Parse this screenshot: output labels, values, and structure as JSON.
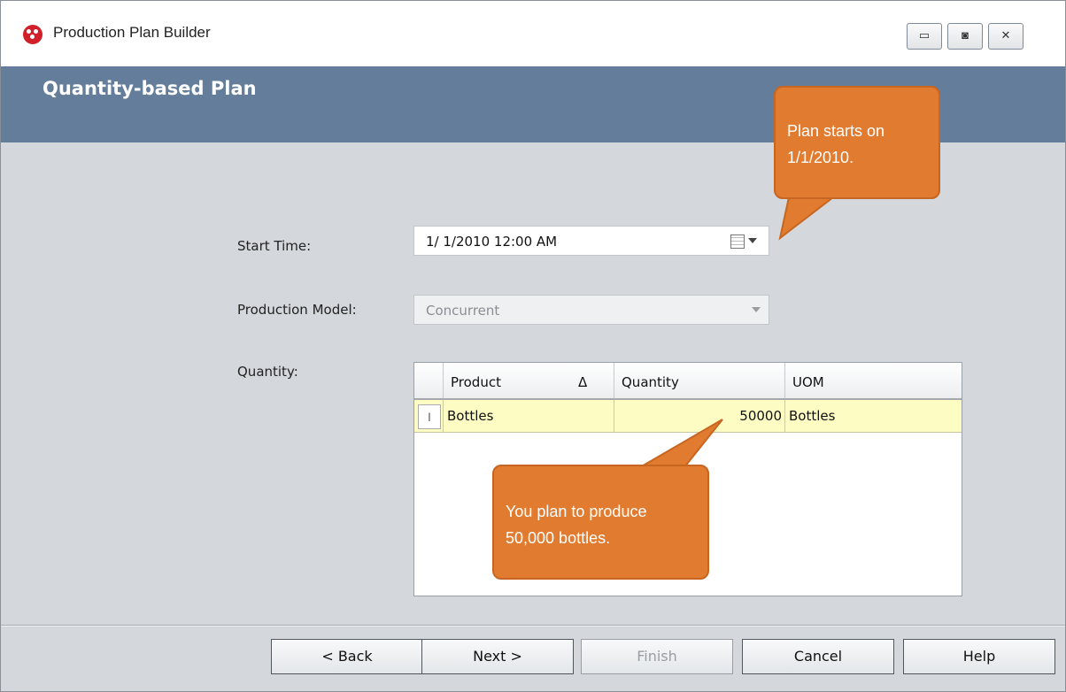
{
  "window": {
    "title": "Production Plan Builder",
    "controls": [
      "minimize",
      "restore",
      "close"
    ]
  },
  "header": {
    "title": "Quantity-based Plan"
  },
  "form": {
    "start_time": {
      "label": "Start Time:",
      "value": "1/  1/2010 12:00 AM"
    },
    "production_model": {
      "label": "Production Model:",
      "value": "Concurrent"
    },
    "quantity": {
      "label": "Quantity:"
    }
  },
  "grid": {
    "columns": [
      "Product",
      "Quantity",
      "UOM"
    ],
    "sort_indicator": "Δ",
    "row_indicator": "I",
    "rows": [
      {
        "product": "Bottles",
        "quantity": "50000",
        "uom": "Bottles"
      }
    ]
  },
  "callouts": {
    "start": [
      "Plan starts on",
      "1/1/2010."
    ],
    "quantity": [
      "You plan to produce",
      "50,000 bottles."
    ]
  },
  "buttons": {
    "back": "< Back",
    "next": "Next >",
    "finish": "Finish",
    "cancel": "Cancel",
    "help": "Help"
  },
  "colors": {
    "header_band": "#637d9b",
    "callout": "#e07b2f",
    "selected_row": "#fdfcc3",
    "body": "#d4d7db"
  }
}
